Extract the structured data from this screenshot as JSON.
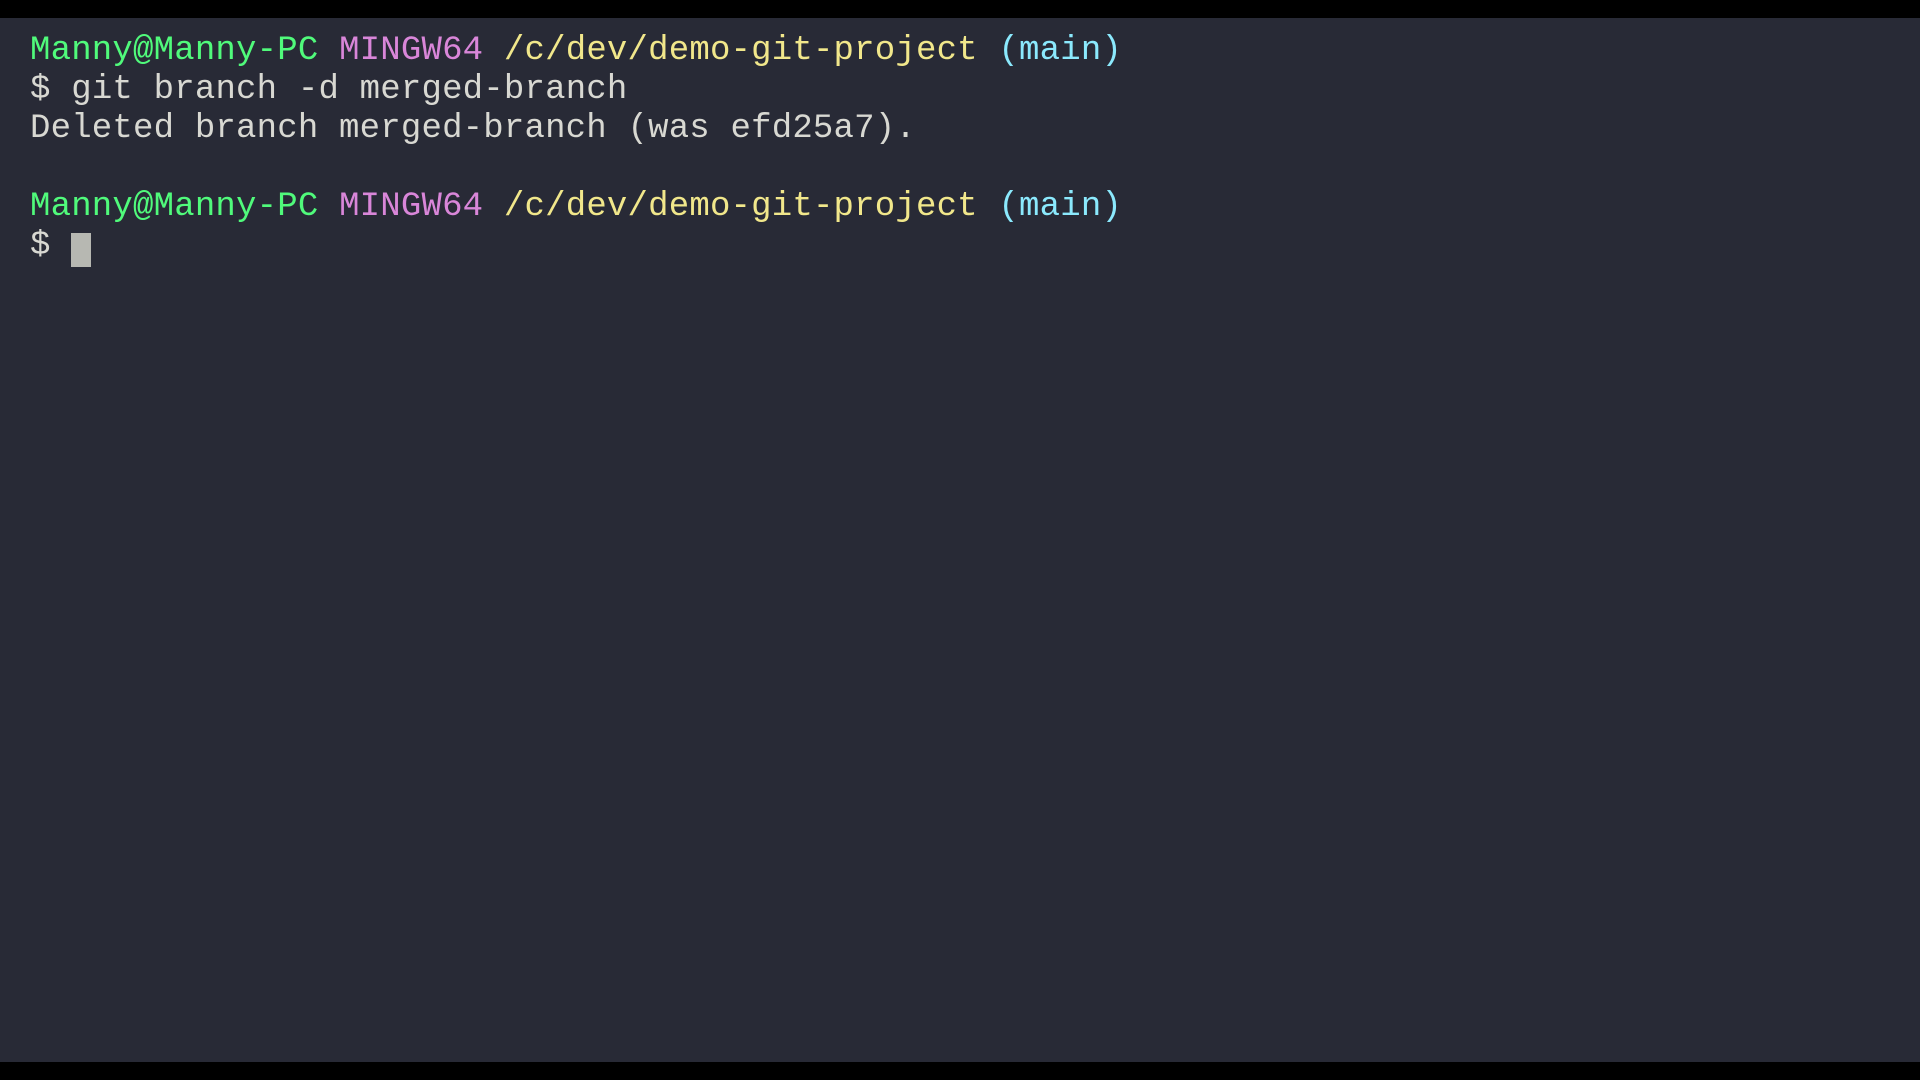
{
  "prompt1": {
    "user_host": "Manny@Manny-PC",
    "mingw": "MINGW64",
    "path": "/c/dev/demo-git-project",
    "branch": "(main)"
  },
  "command1": {
    "symbol": "$",
    "text": "git branch -d merged-branch"
  },
  "output1": "Deleted branch merged-branch (was efd25a7).",
  "prompt2": {
    "user_host": "Manny@Manny-PC",
    "mingw": "MINGW64",
    "path": "/c/dev/demo-git-project",
    "branch": "(main)"
  },
  "command2": {
    "symbol": "$",
    "text": ""
  }
}
